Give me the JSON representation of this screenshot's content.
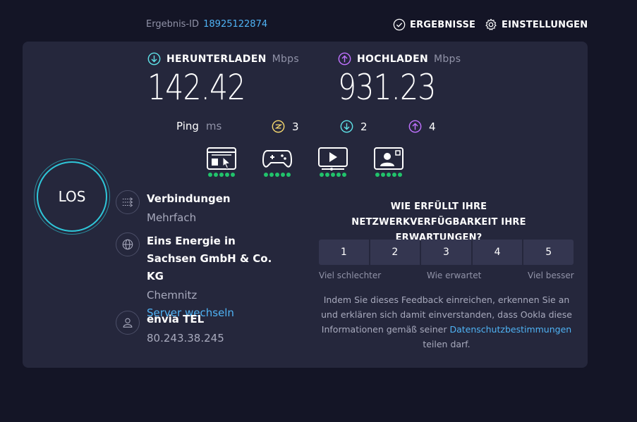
{
  "topbar": {
    "result_id_label": "Ergebnis-ID",
    "result_id": "18925122874",
    "results_button": "ERGEBNISSE",
    "settings_button": "EINSTELLUNGEN"
  },
  "download": {
    "label": "HERUNTERLADEN",
    "unit": "Mbps",
    "value": "142.42"
  },
  "upload": {
    "label": "HOCHLADEN",
    "unit": "Mbps",
    "value": "931.23"
  },
  "ping": {
    "label": "Ping",
    "unit": "ms",
    "idle": "3",
    "download": "2",
    "upload": "4"
  },
  "activities": [
    {
      "icon": "browsing-icon",
      "rating": 5
    },
    {
      "icon": "gaming-icon",
      "rating": 5
    },
    {
      "icon": "streaming-icon",
      "rating": 5
    },
    {
      "icon": "video-call-icon",
      "rating": 5
    }
  ],
  "go_button": "LOS",
  "connections": {
    "title": "Verbindungen",
    "value": "Mehrfach"
  },
  "server": {
    "name": "Eins Energie in Sachsen GmbH & Co. KG",
    "location": "Chemnitz",
    "change_link": "Server wechseln"
  },
  "isp": {
    "name": "envia TEL",
    "ip": "80.243.38.245"
  },
  "survey": {
    "question": "WIE ERFÜLLT IHRE NETZWERKVERFÜGBARKEIT IHRE ERWARTUNGEN?",
    "options": [
      "1",
      "2",
      "3",
      "4",
      "5"
    ],
    "label_low": "Viel schlechter",
    "label_mid": "Wie erwartet",
    "label_high": "Viel besser",
    "consent_before": "Indem Sie dieses Feedback einreichen, erkennen Sie an und erklären sich damit einverstanden, dass Ookla diese Informationen gemäß seiner",
    "consent_link": "Datenschutzbestimmungen",
    "consent_after": "teilen darf."
  },
  "colors": {
    "background": "#141526",
    "panel": "#25273c",
    "download_accent": "#5ee0e6",
    "upload_accent": "#bf71ff",
    "idle_accent": "#f5d76e",
    "link": "#4fb3f5",
    "rating_dot": "#21c36b"
  }
}
